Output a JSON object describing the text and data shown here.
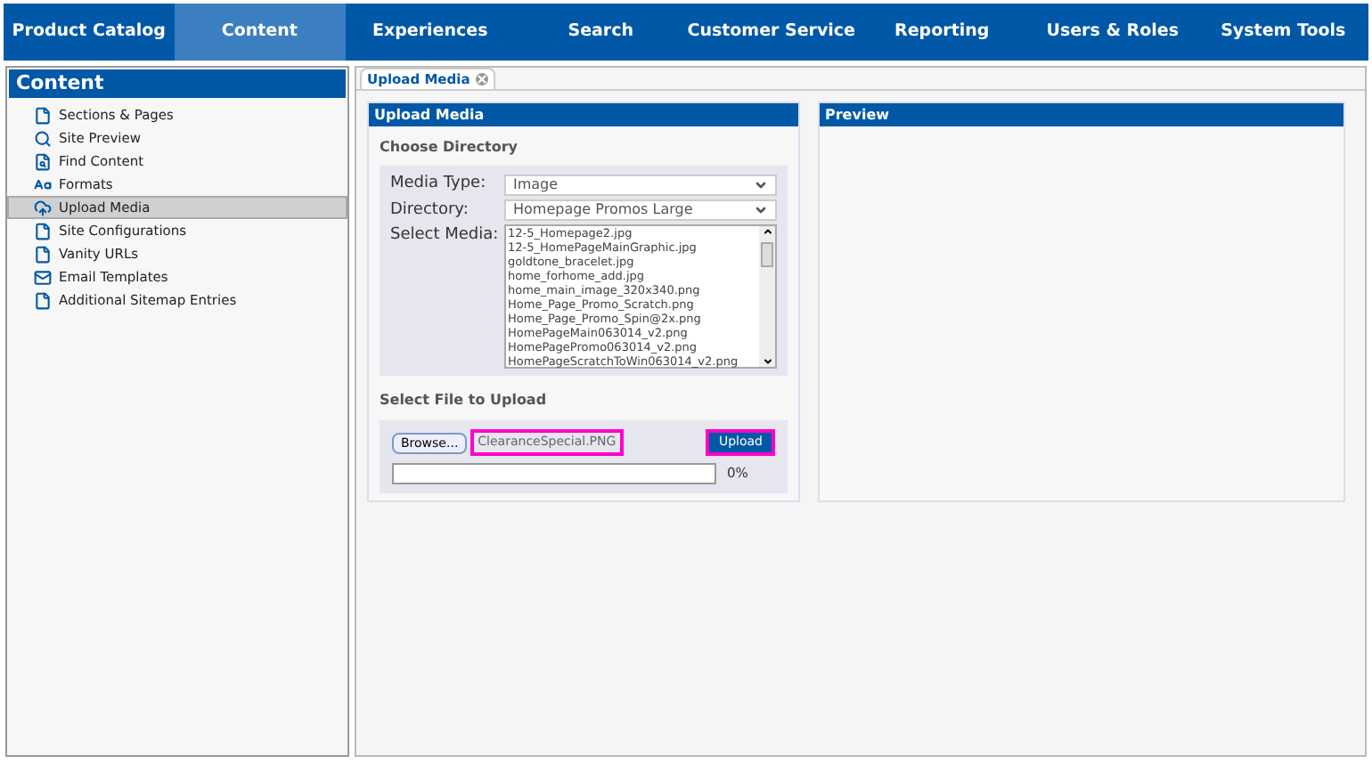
{
  "nav": [
    {
      "label": "Product Catalog",
      "selected": false
    },
    {
      "label": "Content",
      "selected": true
    },
    {
      "label": "Experiences",
      "selected": false
    },
    {
      "label": "Search",
      "selected": false
    },
    {
      "label": "Customer Service",
      "selected": false
    },
    {
      "label": "Reporting",
      "selected": false
    },
    {
      "label": "Users & Roles",
      "selected": false
    },
    {
      "label": "System Tools",
      "selected": false
    }
  ],
  "sidebar": {
    "title": "Content",
    "items": [
      {
        "label": "Sections & Pages",
        "selected": false
      },
      {
        "label": "Site Preview",
        "selected": false
      },
      {
        "label": "Find Content",
        "selected": false
      },
      {
        "label": "Formats",
        "selected": false
      },
      {
        "label": "Upload Media",
        "selected": true
      },
      {
        "label": "Site Configurations",
        "selected": false
      },
      {
        "label": "Vanity URLs",
        "selected": false
      },
      {
        "label": "Email Templates",
        "selected": false
      },
      {
        "label": "Additional Sitemap Entries",
        "selected": false
      }
    ]
  },
  "tab": {
    "label": "Upload Media"
  },
  "upload_panel": {
    "title": "Upload Media",
    "choose_heading": "Choose Directory",
    "media_type": {
      "label": "Media Type:",
      "value": "Image"
    },
    "directory": {
      "label": "Directory:",
      "value": "Homepage Promos Large"
    },
    "select_media": {
      "label": "Select Media:",
      "items": [
        "12-5_Homepage2.jpg",
        "12-5_HomePageMainGraphic.jpg",
        "goldtone_bracelet.jpg",
        "home_forhome_add.jpg",
        "home_main_image_320x340.png",
        "Home_Page_Promo_Scratch.png",
        "Home_Page_Promo_Spin@2x.png",
        "HomePageMain063014_v2.png",
        "HomePagePromo063014_v2.png",
        "HomePageScratchToWin063014_v2.png"
      ]
    },
    "file_heading": "Select File to Upload",
    "browse_button": "Browse...",
    "file_name": {
      "value": "ClearanceSpecial.PNG",
      "highlighted": true
    },
    "upload_button": {
      "label": "Upload",
      "highlighted": true
    },
    "progress": {
      "level": 0,
      "reading": "0%"
    }
  },
  "preview_panel": {
    "title": "Preview"
  }
}
